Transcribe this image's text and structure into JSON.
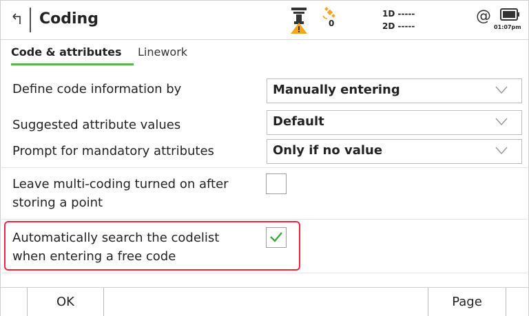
{
  "header": {
    "title": "Coding",
    "satellites": "0",
    "precision_1d": "1D -----",
    "precision_2d": "2D -----",
    "at_symbol": "@",
    "time": "01:07pm",
    "icons": [
      "back-arrow-icon",
      "gnss-receiver-warning-icon",
      "satellite-icon",
      "internet-at-icon",
      "battery-icon"
    ]
  },
  "tabs": {
    "active": "Code & attributes",
    "inactive": "Linework",
    "active_color": "#55b54a"
  },
  "settings": {
    "define_code": {
      "label": "Define code information by",
      "value": "Manually entering"
    },
    "suggested": {
      "label": "Suggested attribute values",
      "value": "Default"
    },
    "prompt": {
      "label": "Prompt for mandatory attributes",
      "value": "Only if no value"
    },
    "leave_multicoding": {
      "label_line1": "Leave multi-coding turned on after",
      "label_line2": "storing a point",
      "checked": false
    },
    "auto_search": {
      "label_line1": "Automatically search the codelist",
      "label_line2": "when entering a free code",
      "checked": true
    }
  },
  "footer": {
    "ok": "OK",
    "page": "Page"
  },
  "colors": {
    "highlight": "#e8283a",
    "check": "#3aa63a",
    "warning": "#f3a51b"
  }
}
